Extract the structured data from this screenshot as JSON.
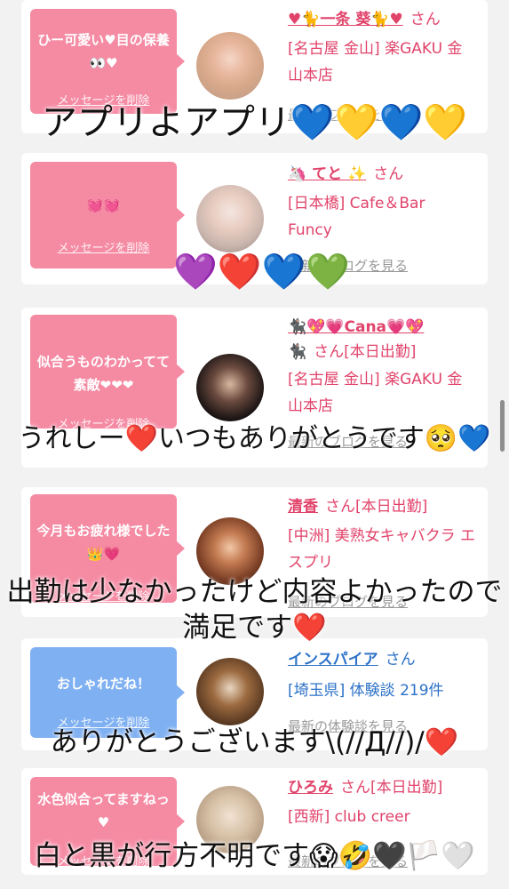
{
  "cards": [
    {
      "message": "ひー可愛い♥目の保養👀♥",
      "delete_label": "メッセージを削除",
      "name": "♥🐈一条 葵🐈♥",
      "san": "さん",
      "shop": "[名古屋 金山] 楽GAKU 金山本店",
      "blog": "最新のブログを見る",
      "bubble_color": "pink"
    },
    {
      "message": "💓💓",
      "delete_label": "メッセージを削除",
      "name": "🦄 てと ✨",
      "san": "さん",
      "shop": "[日本橋] Cafe＆Bar Funcy",
      "blog": "最新のブログを見る",
      "bubble_color": "pink"
    },
    {
      "message": "似合うものわかってて素敵❤❤❤",
      "delete_label": "メッセージを削除",
      "name": "🐈‍⬛💖💗Cana💗💖",
      "name2": "🐈‍⬛",
      "san": "さん[本日出勤]",
      "shop": "[名古屋 金山] 楽GAKU 金山本店",
      "blog": "最新のブログを見る",
      "bubble_color": "pink"
    },
    {
      "message": "今月もお疲れ様でした👑💗",
      "delete_label": "メッセージを削除",
      "name": "清香",
      "san": "さん[本日出勤]",
      "shop": "[中洲] 美熟女キャバクラ エスプリ",
      "blog": "最新のブログを見る",
      "bubble_color": "pink"
    },
    {
      "message": "おしゃれだね！",
      "delete_label": "メッセージを削除",
      "name": "インスパイア",
      "san": "さん",
      "shop": "[埼玉県] 体験談 219件",
      "blog": "最新の体験談を見る",
      "bubble_color": "blue"
    },
    {
      "message": "水色似合ってますねっ♥",
      "delete_label": "メッセージを削除",
      "name": "ひろみ",
      "san": "さん[本日出勤]",
      "shop": "[西新] club creer",
      "blog": "最新のブログを見る",
      "bubble_color": "pink"
    }
  ],
  "overlays": {
    "o1": "アプリよアプリ💙💛💙💛",
    "o2": "💜❤️💙💚",
    "o3": "うれしー❤️いつもありがとうです🥺💙",
    "o4a": "出勤は少なかったけど内容よかったので",
    "o4b": "満足です❤️",
    "o5": "ありがとうございます\\(//Д//)/❤️",
    "o6": "白と黒が行方不明です😱🤣🖤🏳️🤍"
  },
  "colors": {
    "pink": "#f58aa3",
    "blue": "#7fb0f2",
    "name_pink": "#e1436a",
    "name_blue": "#2d72c8"
  }
}
